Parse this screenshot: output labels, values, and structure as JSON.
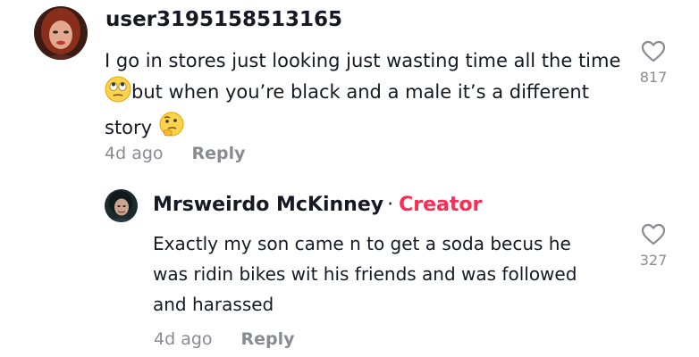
{
  "comments": [
    {
      "username": "user3195158513165",
      "lines": [
        "I go in stores just looking just wasting time all the time",
        "but when you’re black and a male it’s a different",
        "story"
      ],
      "emojis": [
        "face-with-rolling-eyes-emoji",
        "thinking-face-emoji"
      ],
      "time": "4d ago",
      "reply_label": "Reply",
      "like_count": "817"
    },
    {
      "username": "Mrsweirdo McKinney",
      "separator": "·",
      "badge": "Creator",
      "lines": [
        "Exactly my son came n to get a soda becus he",
        "was ridin bikes wit his friends and was followed",
        "and harassed"
      ],
      "time": "4d ago",
      "reply_label": "Reply",
      "like_count": "327"
    }
  ],
  "colors": {
    "text": "#161823",
    "muted": "#8a8b91",
    "creator": "#fe2c55",
    "background": "#ffffff"
  },
  "icons": {
    "like": "heart-outline-icon"
  }
}
